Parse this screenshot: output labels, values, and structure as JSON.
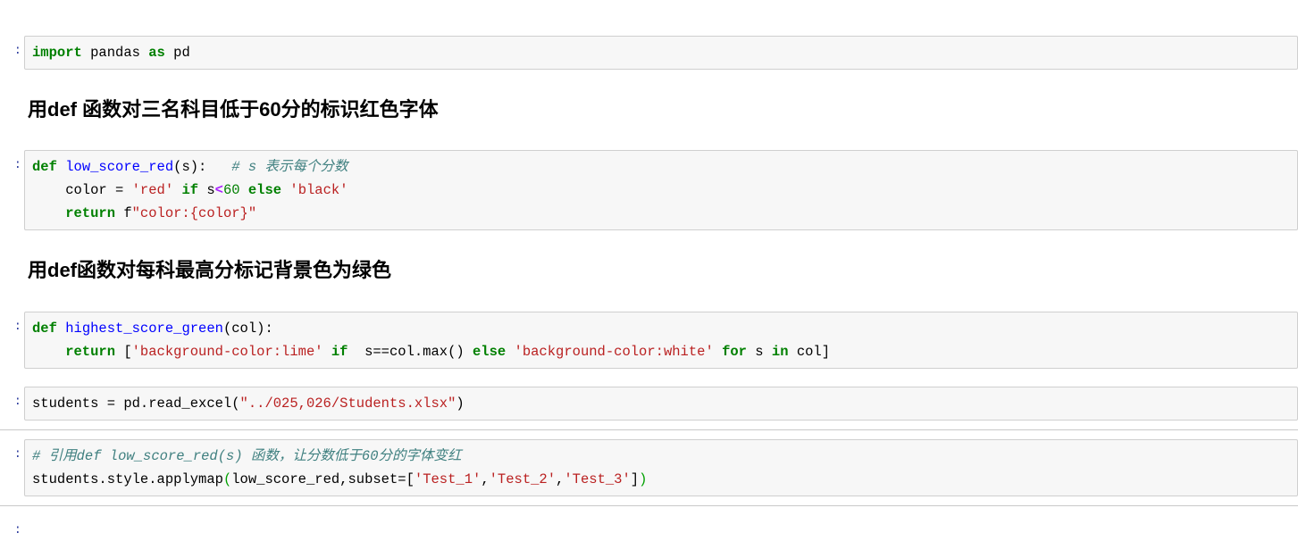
{
  "notebook": {
    "prompt_marker": ":",
    "colors": {
      "keyword": "#008000",
      "function_name": "#0000FF",
      "string": "#BA2121",
      "comment": "#408080",
      "number": "#008000",
      "operator": "#AA22FF",
      "cell_bg": "#F7F7F7",
      "cell_border": "#CFCFCF",
      "prompt": "#303F9F"
    },
    "cells": [
      {
        "type": "code",
        "prompt": ":",
        "lines": [
          [
            {
              "t": "import ",
              "c": "k"
            },
            {
              "t": "pandas ",
              "c": "p"
            },
            {
              "t": "as ",
              "c": "k"
            },
            {
              "t": "pd",
              "c": "p"
            }
          ]
        ]
      },
      {
        "type": "markdown",
        "prompt": "",
        "text": "用def 函数对三名科目低于60分的标识红色字体"
      },
      {
        "type": "code",
        "prompt": ":",
        "lines": [
          [
            {
              "t": "def ",
              "c": "k"
            },
            {
              "t": "low_score_red",
              "c": "nf"
            },
            {
              "t": "(s):   ",
              "c": "p"
            },
            {
              "t": "# s 表示每个分数",
              "c": "c"
            }
          ],
          [
            {
              "t": "    color = ",
              "c": "p"
            },
            {
              "t": "'red'",
              "c": "s"
            },
            {
              "t": " if",
              "c": "k"
            },
            {
              "t": " s",
              "c": "p"
            },
            {
              "t": "<",
              "c": "o"
            },
            {
              "t": "60",
              "c": "mi"
            },
            {
              "t": " else",
              "c": "k"
            },
            {
              "t": " ",
              "c": "p"
            },
            {
              "t": "'black'",
              "c": "s"
            }
          ],
          [
            {
              "t": "    return",
              "c": "k"
            },
            {
              "t": " f",
              "c": "p"
            },
            {
              "t": "\"color:{color}\"",
              "c": "s"
            }
          ]
        ]
      },
      {
        "type": "markdown",
        "prompt": "",
        "text": "用def函数对每科最高分标记背景色为绿色"
      },
      {
        "type": "code",
        "prompt": ":",
        "lines": [
          [
            {
              "t": "def ",
              "c": "k"
            },
            {
              "t": "highest_score_green",
              "c": "nf"
            },
            {
              "t": "(col):",
              "c": "p"
            }
          ],
          [
            {
              "t": "    return",
              "c": "k"
            },
            {
              "t": " [",
              "c": "p"
            },
            {
              "t": "'background-color:lime'",
              "c": "s"
            },
            {
              "t": " if",
              "c": "k"
            },
            {
              "t": "  s==col.max() ",
              "c": "p"
            },
            {
              "t": "else",
              "c": "k"
            },
            {
              "t": " ",
              "c": "p"
            },
            {
              "t": "'background-color:white'",
              "c": "s"
            },
            {
              "t": " for",
              "c": "k"
            },
            {
              "t": " s ",
              "c": "p"
            },
            {
              "t": "in",
              "c": "k"
            },
            {
              "t": " col]",
              "c": "p"
            }
          ]
        ]
      },
      {
        "type": "code",
        "prompt": ":",
        "lines": [
          [
            {
              "t": "students = pd.read_excel(",
              "c": "p"
            },
            {
              "t": "\"../025,026/Students.xlsx\"",
              "c": "s"
            },
            {
              "t": ")",
              "c": "p"
            }
          ]
        ]
      },
      {
        "type": "code",
        "prompt": ":",
        "selected": true,
        "lines": [
          [
            {
              "t": "# 引用def low_score_red(s) 函数，让分数低于60分的字体变红",
              "c": "c"
            }
          ],
          [
            {
              "t": "students.style.applymap",
              "c": "p"
            },
            {
              "t": "(",
              "c": "op-green"
            },
            {
              "t": "low_score_red,subset=[",
              "c": "p"
            },
            {
              "t": "'Test_1'",
              "c": "s"
            },
            {
              "t": ",",
              "c": "p"
            },
            {
              "t": "'Test_2'",
              "c": "s"
            },
            {
              "t": ",",
              "c": "p"
            },
            {
              "t": "'Test_3'",
              "c": "s"
            },
            {
              "t": "]",
              "c": "p"
            },
            {
              "t": ")",
              "c": "op-green"
            }
          ]
        ]
      },
      {
        "type": "code-partial",
        "prompt": ":",
        "lines": []
      }
    ]
  }
}
